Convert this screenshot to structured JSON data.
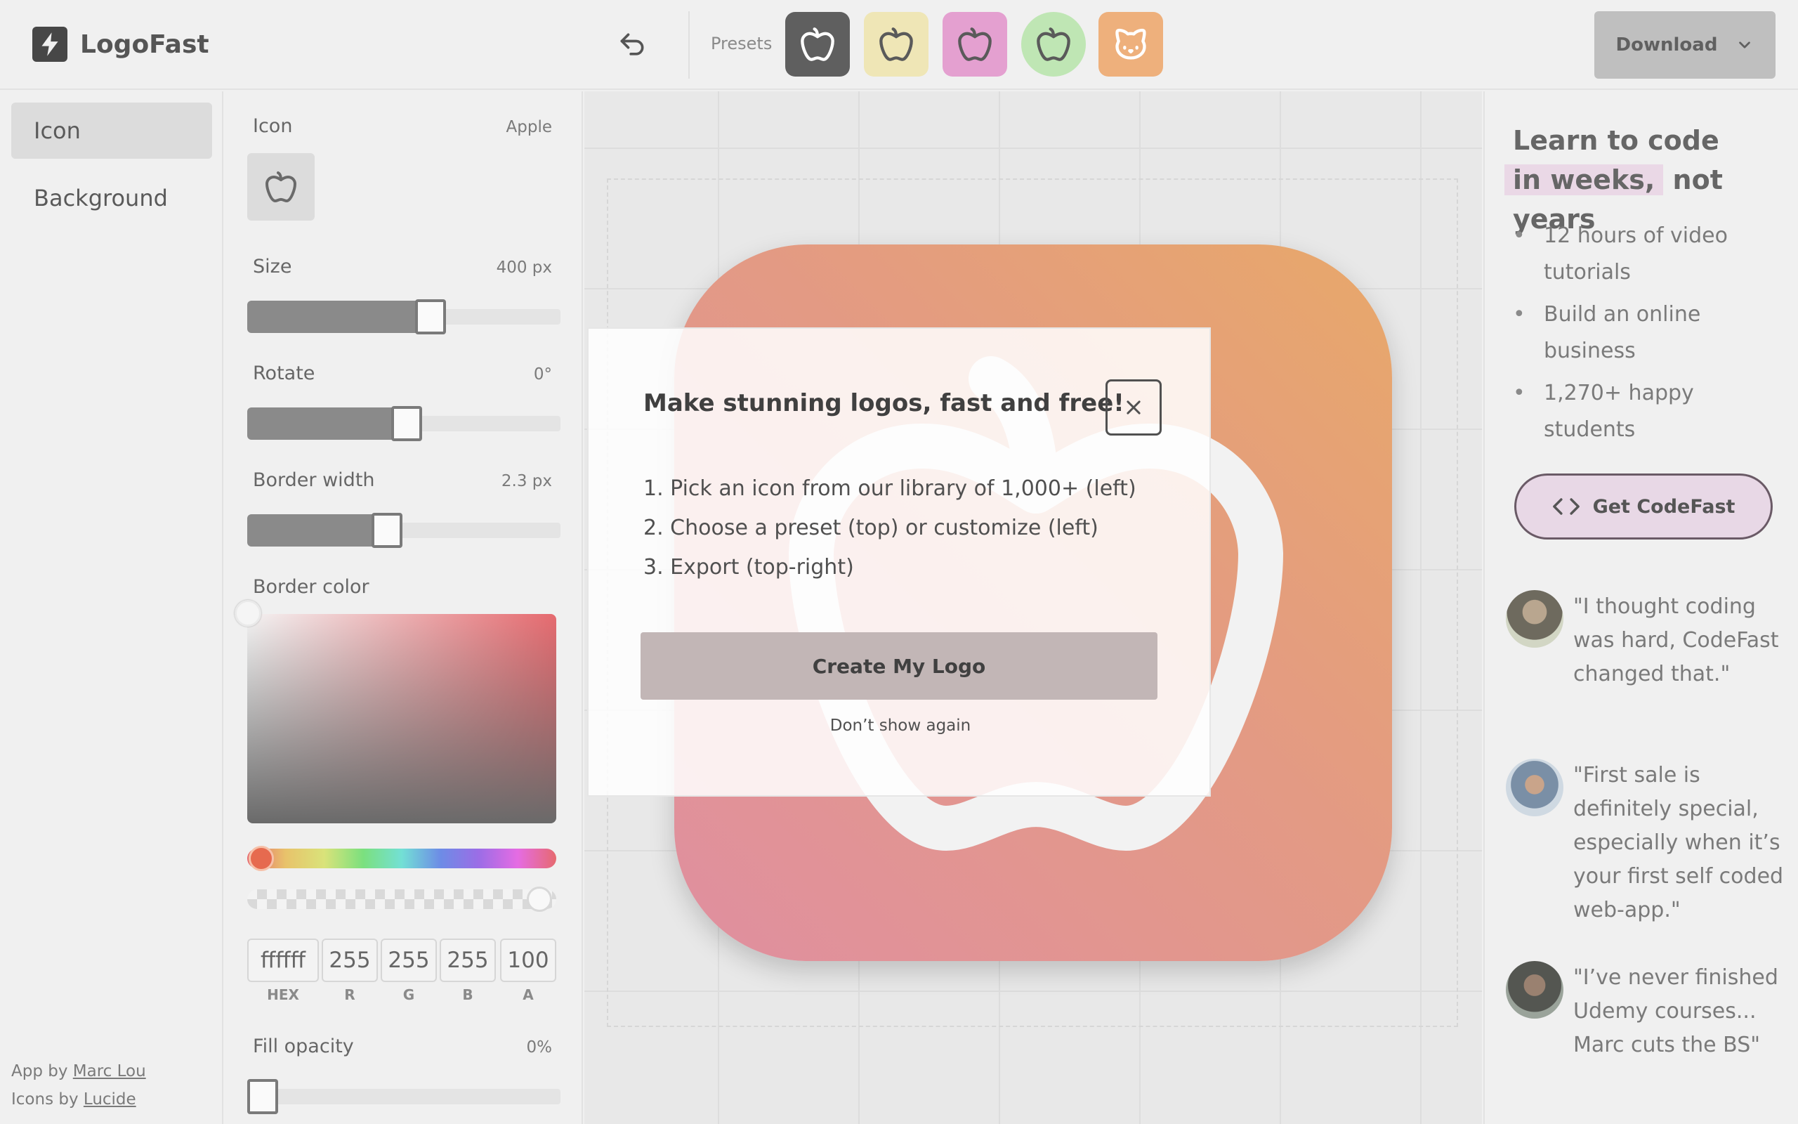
{
  "header": {
    "brand": "LogoFast",
    "presets_label": "Presets",
    "presets": [
      {
        "icon": "apple-icon",
        "bg": "#5f5f5f",
        "fg": "#ffffff"
      },
      {
        "icon": "apple-icon",
        "bg": "#efe6b6",
        "fg": "#5a5a5a"
      },
      {
        "icon": "apple-icon",
        "bg": "#e4a0d0",
        "fg": "#5a5a5a"
      },
      {
        "icon": "apple-icon",
        "bg": "#bfe6b4",
        "fg": "#5a5a5a"
      },
      {
        "icon": "cat-icon",
        "bg": "#eeb07c",
        "fg": "#ffffff"
      }
    ],
    "download_label": "Download"
  },
  "sidebar": {
    "items": [
      {
        "label": "Icon",
        "active": true
      },
      {
        "label": "Background",
        "active": false
      }
    ],
    "credits": {
      "app_prefix": "App by",
      "app_author": "Marc Lou",
      "icons_prefix": "Icons by",
      "icons_author": "Lucide"
    }
  },
  "controls": {
    "icon": {
      "label": "Icon",
      "value": "Apple"
    },
    "size": {
      "label": "Size",
      "value": "400 px",
      "fraction": 0.595
    },
    "rotate": {
      "label": "Rotate",
      "value": "0°",
      "fraction": 0.51
    },
    "border_width": {
      "label": "Border width",
      "value": "2.3 px",
      "fraction": 0.44
    },
    "border_color": {
      "label": "Border color",
      "hex": "ffffff",
      "r": "255",
      "g": "255",
      "b": "255",
      "a": "100",
      "hex_label": "HEX",
      "r_label": "R",
      "g_label": "G",
      "b_label": "B",
      "a_label": "A"
    },
    "fill_opacity": {
      "label": "Fill opacity",
      "value": "0%",
      "fraction": 0.0
    }
  },
  "modal": {
    "title": "Make stunning logos, fast and free!",
    "steps": [
      "1. Pick an icon from our library of 1,000+ (left)",
      "2. Choose a preset (top) or customize (left)",
      "3. Export (top-right)"
    ],
    "cta": "Create My Logo",
    "dismiss": "Don’t show again"
  },
  "promo": {
    "title_line1": "Learn to code",
    "title_highlight": "in weeks,",
    "title_rest": "not years",
    "bullets": [
      "12 hours of video tutorials",
      "Build an online business",
      "1,270+ happy students"
    ],
    "button_label": "Get CodeFast",
    "testimonials": [
      {
        "quote": "\"I thought coding was hard, CodeFast changed that.\""
      },
      {
        "quote": "\"First sale is definitely special, especially when it’s your first self coded web-app.\""
      },
      {
        "quote": "\"I’ve never finished Udemy courses... Marc cuts the BS\""
      }
    ]
  },
  "colors": {
    "accent": "#e8d8e6",
    "logo_gradient_start": "#e8a86a",
    "logo_gradient_end": "#e08fa0"
  }
}
